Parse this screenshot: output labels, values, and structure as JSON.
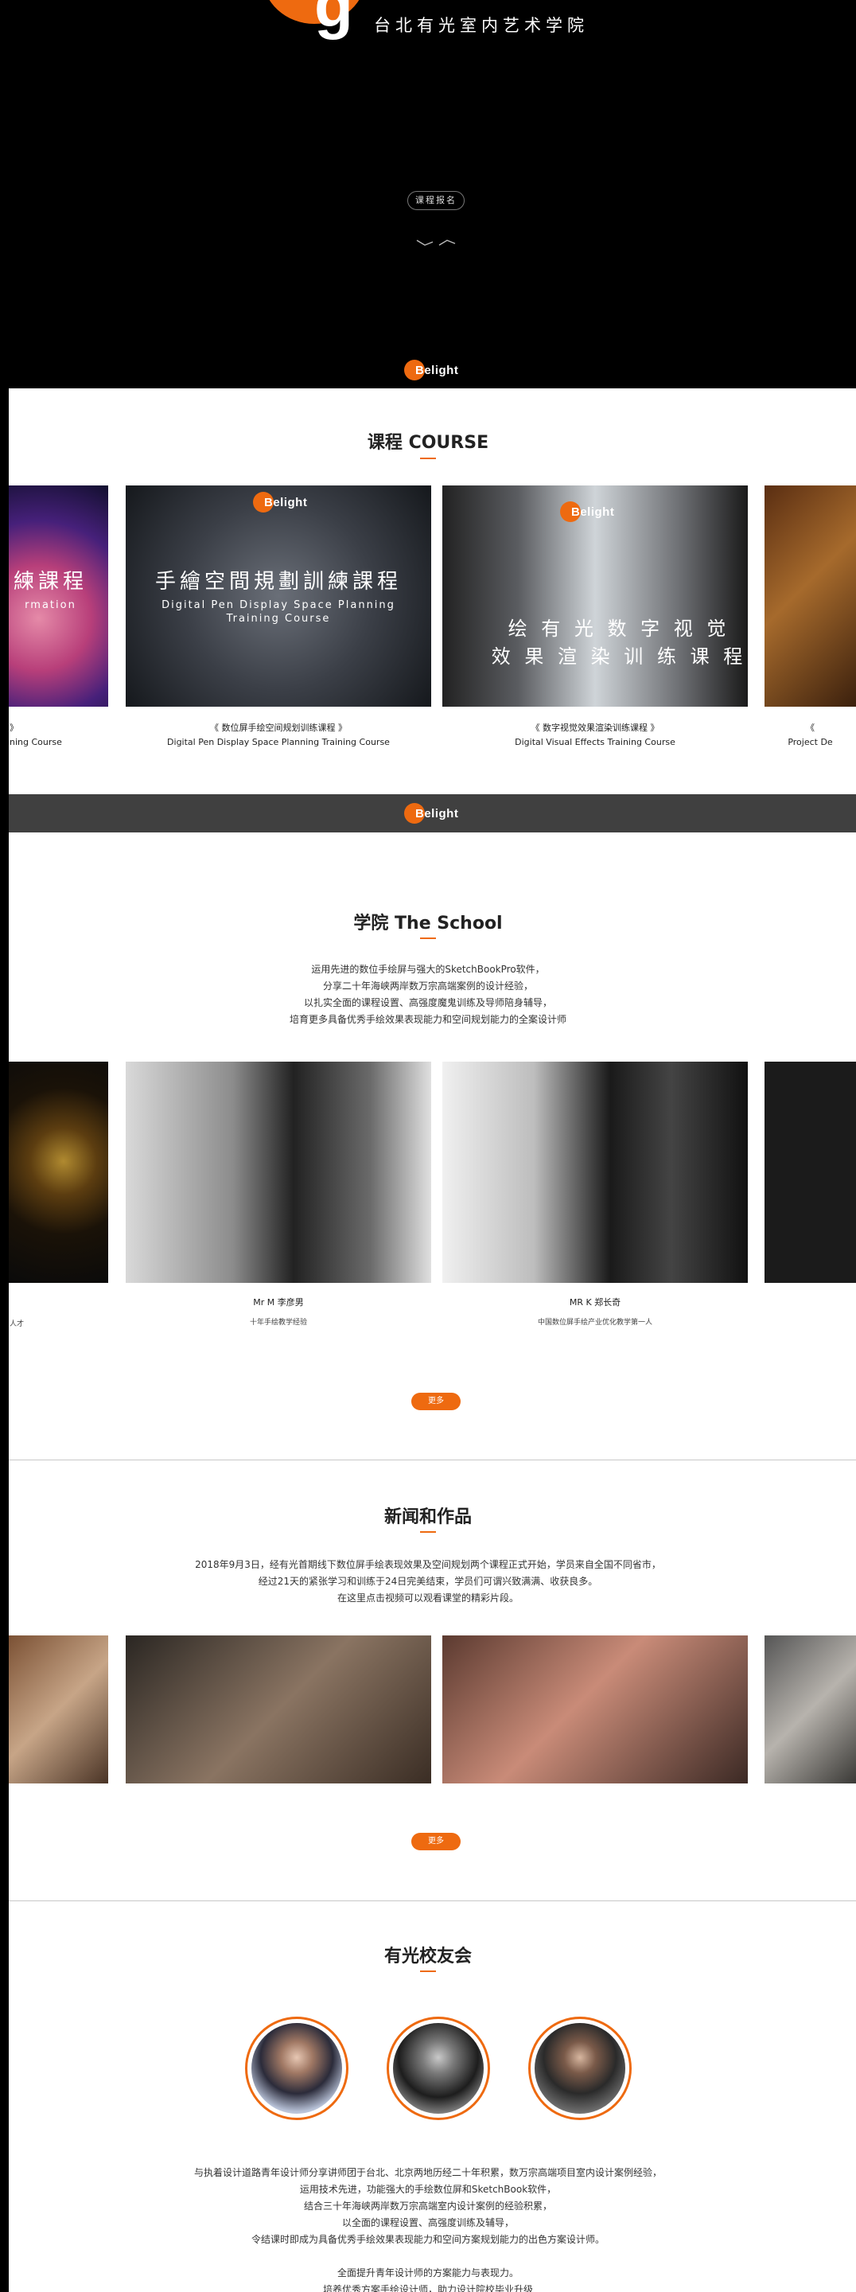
{
  "hero": {
    "subtitle": "台北有光室内艺术学院",
    "register_button": "课程报名",
    "brand": "Belight"
  },
  "course": {
    "title": "课程 COURSE",
    "items": [
      {
        "caption_cn": "》",
        "caption_en": "ning Course",
        "overlay_cn": "練課程",
        "overlay_en": "rmation"
      },
      {
        "caption_cn": "《 数位屏手绘空间规划训练课程 》",
        "caption_en": "Digital Pen Display Space Planning Training Course",
        "overlay_cn": "手繪空間規劃訓練課程",
        "overlay_en1": "Digital Pen Display Space Planning",
        "overlay_en2": "Training Course",
        "brand": "Belight"
      },
      {
        "caption_cn": "《 数字视觉效果渲染训练课程 》",
        "caption_en": "Digital Visual Effects Training Course",
        "overlay_cn1": "绘 有 光 数 字 视 觉",
        "overlay_cn2": "效 果 渲 染 训 练 课 程",
        "brand": "Belight"
      },
      {
        "caption_cn": "《",
        "caption_en": "Project De"
      }
    ]
  },
  "band": {
    "brand": "Belight"
  },
  "school": {
    "title": "学院 The School",
    "lines": [
      "运用先进的数位手绘屏与强大的SketchBookPro软件，",
      "分享二十年海峡两岸数万宗高端案例的设计经验，",
      "以扎实全面的课程设置、高强度魔鬼训练及导师陪身辅导，",
      "培育更多具备优秀手绘效果表现能力和空间规划能力的全案设计师"
    ],
    "people": [
      {
        "name": "",
        "desc": "人才"
      },
      {
        "name": "Mr M 李彦男",
        "desc": "十年手绘教学经验"
      },
      {
        "name": "MR K 郑长奇",
        "desc": "中国数位屏手绘产业优化教学第一人"
      },
      {
        "name": "",
        "desc": ""
      }
    ],
    "more": "更多"
  },
  "news": {
    "title": "新闻和作品",
    "lines": [
      "2018年9月3日，经有光首期线下数位屏手绘表现效果及空间规划两个课程正式开始，学员来自全国不同省市，",
      "经过21天的紧张学习和训练于24日完美结束，学员们可谓兴致满满、收获良多。",
      "在这里点击视频可以观看课堂的精彩片段。"
    ],
    "more": "更多"
  },
  "alumni": {
    "title": "有光校友会",
    "lines": [
      "与执着设计道路青年设计师分享讲师团于台北、北京两地历经二十年积累，数万宗高端项目室内设计案例经验，",
      "运用技术先进，功能强大的手绘数位屏和SketchBook软件，",
      "结合三十年海峡两岸数万宗高端室内设计案例的经验积累，",
      "以全面的课程设置、高强度训练及辅导，",
      "令结课时即成为具备优秀手绘效果表现能力和空间方案规划能力的出色方案设计师。",
      "",
      "全面提升青年设计师的方案能力与表现力。",
      "培养优秀方案手绘设计师，助力设计院校毕业升级"
    ]
  }
}
